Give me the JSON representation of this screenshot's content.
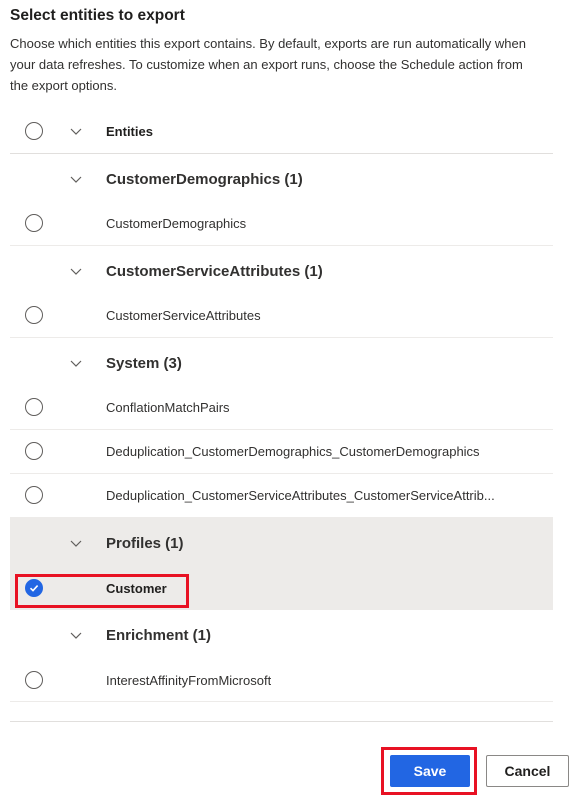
{
  "panel": {
    "title": "Select entities to export",
    "description": "Choose which entities this export contains. By default, exports are run automatically when your data refreshes. To customize when an export runs, choose the Schedule action from the export options."
  },
  "grid": {
    "header_label": "Entities",
    "groups": [
      {
        "label": "CustomerDemographics (1)",
        "items": [
          "CustomerDemographics"
        ]
      },
      {
        "label": "CustomerServiceAttributes (1)",
        "items": [
          "CustomerServiceAttributes"
        ]
      },
      {
        "label": "System (3)",
        "items": [
          "ConflationMatchPairs",
          "Deduplication_CustomerDemographics_CustomerDemographics",
          "Deduplication_CustomerServiceAttributes_CustomerServiceAttrib..."
        ]
      },
      {
        "label": "Profiles (1)",
        "items": [
          "Customer"
        ]
      },
      {
        "label": "Enrichment (1)",
        "items": [
          "InterestAffinityFromMicrosoft"
        ]
      }
    ],
    "selected_item": "Customer"
  },
  "footer": {
    "save_label": "Save",
    "cancel_label": "Cancel"
  },
  "colors": {
    "accent": "#2266e3",
    "highlight_border": "#e81123",
    "selected_row": "#edebe9"
  }
}
